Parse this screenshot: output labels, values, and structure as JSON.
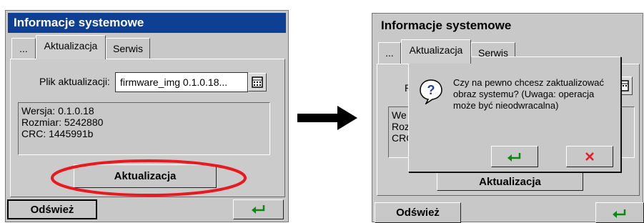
{
  "left_screen": {
    "title": "Informacje systemowe",
    "tabs": [
      "...",
      "Aktualizacja",
      "Serwis"
    ],
    "file_label": "Plik aktualizacji:",
    "file_value": "firmware_img 0.1.0.18...",
    "info": {
      "version": "Wersja: 0.1.0.18",
      "size": "Rozmiar: 5242880",
      "crc": "CRC: 1445991b"
    },
    "update_button": "Aktualizacja",
    "refresh_button": "Odśwież",
    "highlight_color": "#e8191f"
  },
  "right_screen": {
    "title": "Informacje systemowe",
    "tabs": [
      "...",
      "Aktualizacja",
      "Serwis"
    ],
    "partial_file_label": "P",
    "partial_info": [
      "We",
      "Roz",
      "CRC"
    ],
    "update_button": "Aktualizacja",
    "refresh_button": "Odśwież",
    "dialog": {
      "icon": "question-icon",
      "message": "Czy na pewno chcesz zaktualizować obraz systemu? (Uwaga: operacja może być nieodwracalna)"
    }
  },
  "arrow": "arrow-right-icon"
}
